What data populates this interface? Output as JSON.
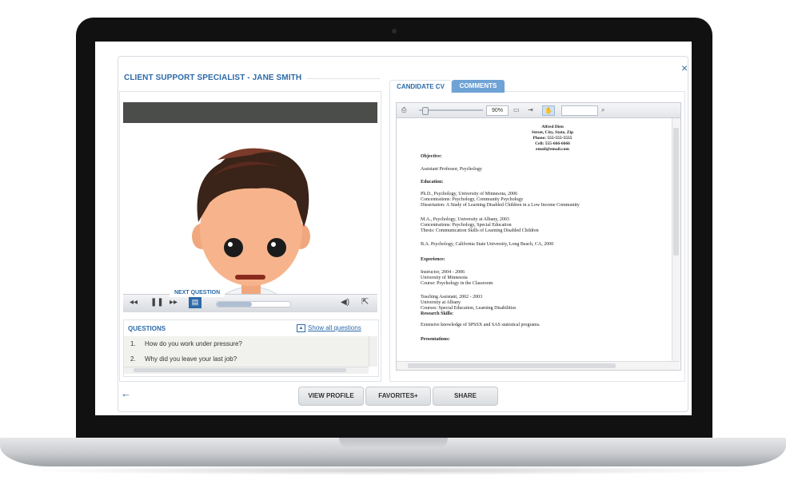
{
  "app": {
    "title": "CLIENT SUPPORT SPECIALIST - JANE SMITH",
    "close_label": "×"
  },
  "video": {
    "tooltip": "NEXT QUESTION",
    "progress": 0.48,
    "controls": {
      "rewind_icon": "◂◂",
      "pause_icon": "❚❚",
      "next_icon": "▸▸",
      "volume_icon": "◀)",
      "popout_icon": "⇱"
    }
  },
  "questions": {
    "title": "QUESTIONS",
    "show_all": "Show all questions",
    "items": [
      {
        "num": "1.",
        "text": "How do you work under pressure?"
      },
      {
        "num": "2.",
        "text": "Why did you leave your last job?"
      }
    ]
  },
  "tabs": [
    {
      "label": "CANDIDATE CV",
      "active": true
    },
    {
      "label": "COMMENTS",
      "active": false
    }
  ],
  "viewer": {
    "zoom": "90%",
    "search_placeholder": ""
  },
  "cv": {
    "name": "Alfred Dien",
    "address": "Street, City, State, Zip",
    "phone": "Phone: 555-555-5555",
    "cell": "Cell: 555-666-6666",
    "email": "email@email.com",
    "objective_h": "Objective:",
    "objective": "Assistant Professor, Psychology",
    "education_h": "Education:",
    "phd": "Ph.D., Psychology, University of Minnesota, 2006",
    "phd_conc": "Concentrations: Psychology, Community Psychology",
    "phd_diss": "Dissertation: A Study of Learning Disabled Children in a Low Income Community",
    "ma": "M.A., Psychology, University at Albany, 2003",
    "ma_conc": "Concentrations: Psychology, Special Education",
    "ma_thesis": "Thesis: Communication Skills of Learning Disabled Children",
    "ba": "B.A. Psychology, California State University, Long Beach, CA, 2000",
    "experience_h": "Experience:",
    "exp1_a": "Instructor, 2004 - 2006",
    "exp1_b": "University of Minnesota",
    "exp1_c": "Course: Psychology in the Classroom",
    "exp2_a": "Teaching Assistant, 2002 - 2003",
    "exp2_b": "University at Albany",
    "exp2_c": "Courses: Special Education, Learning Disabilities",
    "research_h": "Research Skills:",
    "research": "Extensive knowledge of SPSSX and SAS statistical programs.",
    "presentations_h": "Presentations:"
  },
  "footer": {
    "back_icon": "←",
    "view_profile": "VIEW PROFILE",
    "favorites": "FAVORITES+",
    "share": "SHARE"
  }
}
